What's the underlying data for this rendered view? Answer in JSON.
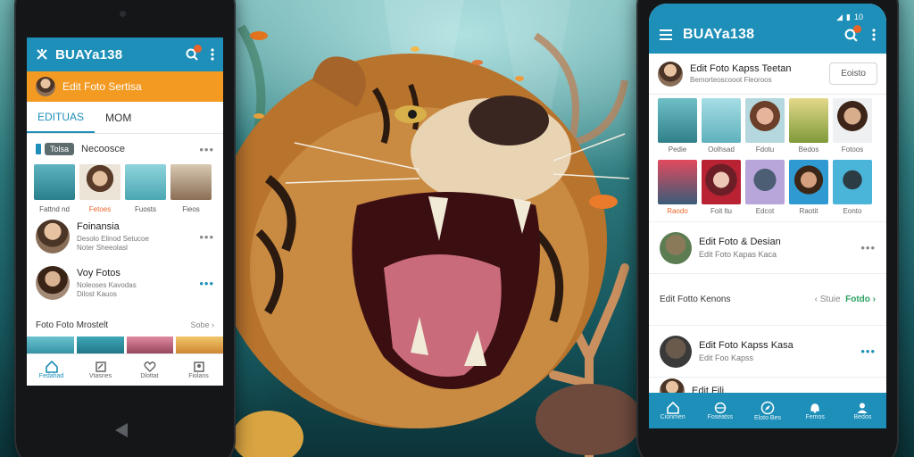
{
  "left_app": {
    "brand": "BUAYa138",
    "banner_text": "Edit Foto Sertisa",
    "tabs": [
      {
        "label": "EDITUAS"
      },
      {
        "label": "MOM"
      }
    ],
    "recent_label": "Necoosce",
    "recent_chip": "Tolsa",
    "thumbs": [
      {
        "caption": "Fattnd nd"
      },
      {
        "caption": "Fetoes"
      },
      {
        "caption": "Fuosts"
      },
      {
        "caption": "Fieos"
      }
    ],
    "list": [
      {
        "title": "Foinansia",
        "sub1": "Desolo Elinod Setucoe",
        "sub2": "Noter Sheeolasl"
      },
      {
        "title": "Voy Fotos",
        "sub1": "Noleoses Kavodas",
        "sub2": "Dilost Kauos"
      }
    ],
    "section_title": "Foto Foto Mrostelt",
    "section_more": "Sobe ›",
    "nav": [
      {
        "label": "Fedahad",
        "icon": "home-icon"
      },
      {
        "label": "Vtasnes",
        "icon": "edit-icon"
      },
      {
        "label": "Dlottat",
        "icon": "heart-icon"
      },
      {
        "label": "Fiolans",
        "icon": "profile-icon"
      }
    ]
  },
  "right_app": {
    "brand": "BUAYa138",
    "status_time": "10",
    "head_title": "Edit Foto Kapss Teetan",
    "head_sub": "Bemorteoscooot Fleoroos",
    "edit_button": "Eoisto",
    "grid": [
      {
        "caption": "Pedie"
      },
      {
        "caption": "Oolhsad"
      },
      {
        "caption": "Fdotu"
      },
      {
        "caption": "Bedos"
      },
      {
        "caption": "Fotoos"
      },
      {
        "caption": "Raodo"
      },
      {
        "caption": "Foit ltu"
      },
      {
        "caption": "Edcot"
      },
      {
        "caption": "Raotit"
      },
      {
        "caption": "Eonto"
      }
    ],
    "list": [
      {
        "title": "Edit Foto & Desian",
        "sub": "Edit Foto Kapas Kaca"
      },
      {
        "title": "Edit Foto Kapss Kasa",
        "sub": "Edit Foo Kapss"
      }
    ],
    "kartu_label": "Edit Fotto Kenons",
    "kartu_right_a": "‹ Stuie",
    "kartu_right_b": "Fotdo ›",
    "partial_item": "Edit Fili",
    "nav": [
      {
        "label": "Cionmen",
        "icon": "home-icon"
      },
      {
        "label": "Foseatss",
        "icon": "globe-icon"
      },
      {
        "label": "Eloto Bes",
        "icon": "compass-icon"
      },
      {
        "label": "Femos",
        "icon": "bell-icon"
      },
      {
        "label": "Bedos",
        "icon": "profile-icon"
      }
    ]
  },
  "colors": {
    "brand_blue": "#1e8fb8",
    "banner_orange": "#f39a22",
    "badge_orange": "#e9642b"
  }
}
